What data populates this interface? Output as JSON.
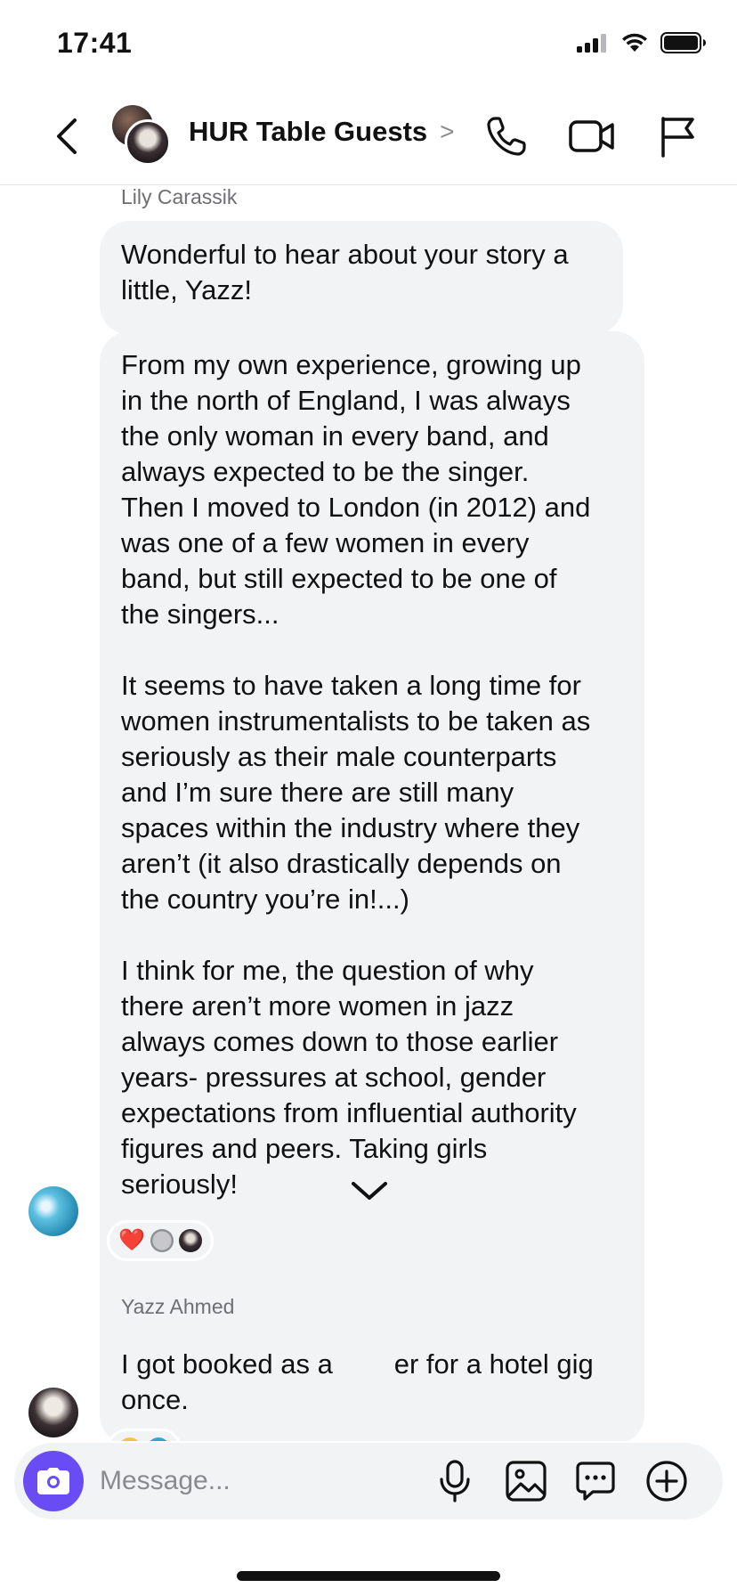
{
  "status_bar": {
    "time": "17:41",
    "icons": [
      "cellular-signal-icon",
      "wifi-icon",
      "battery-icon"
    ]
  },
  "header": {
    "back_icon": "chevron-left-icon",
    "title": "HUR Table Guests",
    "title_chevron": ">",
    "actions": [
      "phone-icon",
      "video-camera-icon",
      "flag-icon"
    ]
  },
  "messages": [
    {
      "sender": "Lily Carassik",
      "bubbles": [
        "Wonderful to hear about your story a\nlittle, Yazz!",
        "From my own experience, growing up\nin the north of England, I was always\nthe only woman in every band, and\nalways expected to be the singer.\nThen I moved to London (in 2012) and\nwas one of a few women in every\nband, but still expected to be one of\nthe singers...\n\nIt seems to have taken a long time for\nwomen instrumentalists to be taken as\nseriously as their male counterparts\nand I’m sure there are still many\nspaces within the industry where they\naren’t (it also drastically depends on\nthe country you’re in!...)\n\nI think for me, the question of why\nthere aren’t more women in jazz\nalways comes down to those earlier\nyears- pressures at school, gender\nexpectations from influential authority\nfigures and peers. Taking girls\nseriously!"
      ],
      "reactions": {
        "emoji": "❤️",
        "reactor_icons": [
          "reactor-avatar-grey",
          "reactor-avatar-photo"
        ]
      }
    },
    {
      "sender": "Yazz Ahmed",
      "bubbles": [
        "I got booked as a        er for a hotel gig\nonce."
      ]
    }
  ],
  "scroll_down_icon": "chevron-down-icon",
  "composer": {
    "placeholder": "Message...",
    "icons": [
      "camera-icon",
      "microphone-icon",
      "image-icon",
      "sticker-chat-icon",
      "add-circle-icon"
    ]
  },
  "colors": {
    "accent": "#6a4cf5",
    "bubble_bg": "#f2f3f5",
    "secondary_text": "#6e6e73"
  }
}
